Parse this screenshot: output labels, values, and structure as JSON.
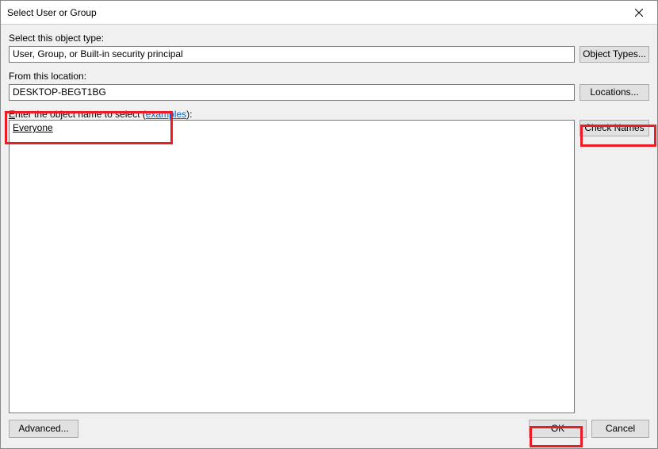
{
  "title": "Select User or Group",
  "labels": {
    "object_type": "Select this object type:",
    "from_location": "From this location:",
    "enter_name_prefix": "E",
    "enter_name_rest": "nter the object name to select (",
    "examples": "examples",
    "enter_name_suffix": "):"
  },
  "fields": {
    "object_type": "User, Group, or Built-in security principal",
    "location": "DESKTOP-BEGT1BG",
    "object_name": "Everyone"
  },
  "buttons": {
    "object_types": "Object Types...",
    "locations": "Locations...",
    "check_names": "Check Names",
    "advanced": "Advanced...",
    "ok": "OK",
    "cancel": "Cancel"
  }
}
